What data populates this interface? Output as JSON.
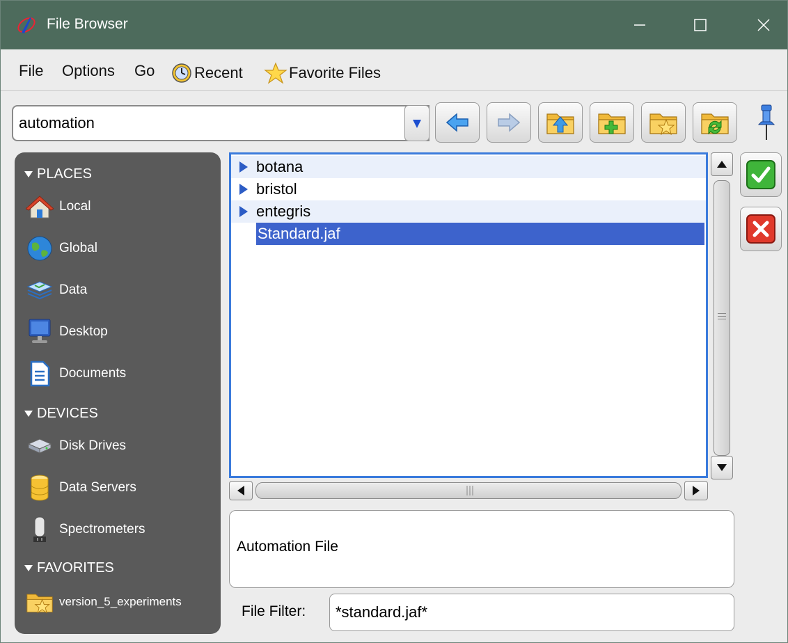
{
  "window": {
    "title": "File Browser",
    "min_icon": "minimize-icon",
    "max_icon": "maximize-icon",
    "close_icon": "close-icon"
  },
  "menu": {
    "file": "File",
    "options": "Options",
    "go": "Go",
    "recent": "Recent",
    "favorite_files": "Favorite Files"
  },
  "toolbar": {
    "path": "automation"
  },
  "sidebar": {
    "places_header": "PLACES",
    "places": [
      {
        "label": "Local",
        "icon": "home-icon"
      },
      {
        "label": "Global",
        "icon": "globe-icon"
      },
      {
        "label": "Data",
        "icon": "data-layers-icon"
      },
      {
        "label": "Desktop",
        "icon": "monitor-icon"
      },
      {
        "label": "Documents",
        "icon": "document-icon"
      }
    ],
    "devices_header": "DEVICES",
    "devices": [
      {
        "label": "Disk Drives",
        "icon": "disk-drive-icon"
      },
      {
        "label": "Data Servers",
        "icon": "database-icon"
      },
      {
        "label": "Spectrometers",
        "icon": "spectrometer-icon"
      }
    ],
    "favorites_header": "FAVORITES",
    "favorites": [
      {
        "label": "version_5_experiments",
        "icon": "favorite-folder-icon"
      }
    ]
  },
  "files": [
    {
      "name": "botana",
      "type": "folder"
    },
    {
      "name": "bristol",
      "type": "folder"
    },
    {
      "name": "entegris",
      "type": "folder"
    },
    {
      "name": "Standard.jaf",
      "type": "file",
      "selected": true
    }
  ],
  "description": "Automation File",
  "filter": {
    "label": "File Filter:",
    "value": "*standard.jaf*"
  },
  "colors": {
    "titlebar": "#4d6b5c",
    "sidebar": "#5a5a5a",
    "selection": "#3d63cc",
    "list_border": "#3b7bdc"
  }
}
